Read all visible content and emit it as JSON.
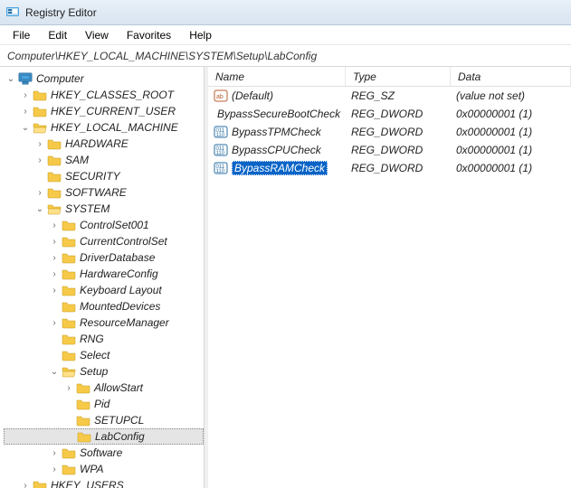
{
  "titlebar": {
    "title": "Registry Editor"
  },
  "menubar": {
    "file": "File",
    "edit": "Edit",
    "view": "View",
    "favorites": "Favorites",
    "help": "Help"
  },
  "addressbar": {
    "path": "Computer\\HKEY_LOCAL_MACHINE\\SYSTEM\\Setup\\LabConfig"
  },
  "tree": {
    "root": "Computer",
    "nodes": {
      "hkcr": "HKEY_CLASSES_ROOT",
      "hkcu": "HKEY_CURRENT_USER",
      "hklm": "HKEY_LOCAL_MACHINE",
      "hardware": "HARDWARE",
      "sam": "SAM",
      "security": "SECURITY",
      "software": "SOFTWARE",
      "system": "SYSTEM",
      "controlset001": "ControlSet001",
      "currentcontrolset": "CurrentControlSet",
      "driverdatabase": "DriverDatabase",
      "hardwareconfig": "HardwareConfig",
      "keyboardlayout": "Keyboard Layout",
      "mounteddevices": "MountedDevices",
      "resourcemanager": "ResourceManager",
      "rng": "RNG",
      "select": "Select",
      "setup": "Setup",
      "allowstart": "AllowStart",
      "pid": "Pid",
      "setupcl": "SETUPCL",
      "labconfig": "LabConfig",
      "software2": "Software",
      "wpa": "WPA",
      "hku": "HKEY_USERS"
    }
  },
  "list": {
    "headers": {
      "name": "Name",
      "type": "Type",
      "data": "Data"
    },
    "rows": [
      {
        "icon": "str",
        "name": "(Default)",
        "type": "REG_SZ",
        "data": "(value not set)",
        "selected": false
      },
      {
        "icon": "bin",
        "name": "BypassSecureBootCheck",
        "type": "REG_DWORD",
        "data": "0x00000001 (1)",
        "selected": false
      },
      {
        "icon": "bin",
        "name": "BypassTPMCheck",
        "type": "REG_DWORD",
        "data": "0x00000001 (1)",
        "selected": false
      },
      {
        "icon": "bin",
        "name": "BypassCPUCheck",
        "type": "REG_DWORD",
        "data": "0x00000001 (1)",
        "selected": false
      },
      {
        "icon": "bin",
        "name": "BypassRAMCheck",
        "type": "REG_DWORD",
        "data": "0x00000001 (1)",
        "selected": true
      }
    ]
  }
}
